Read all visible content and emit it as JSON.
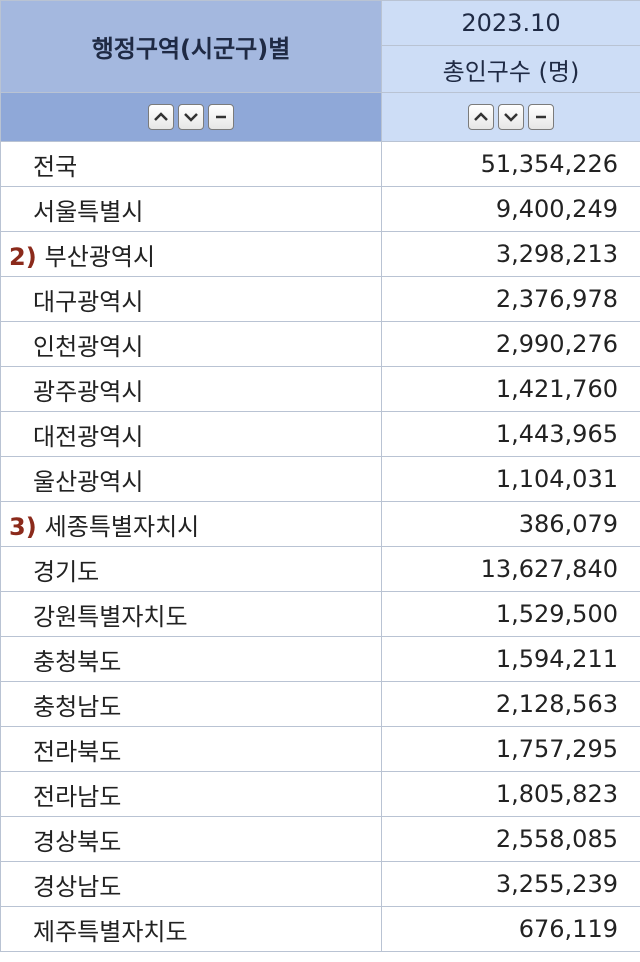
{
  "header": {
    "region_label": "행정구역(시군구)별",
    "period": "2023.10",
    "measure": "총인구수 (명)"
  },
  "controls": {
    "up_icon": "chevron-up-icon",
    "down_icon": "chevron-down-icon",
    "remove_icon": "minus-icon"
  },
  "rows": [
    {
      "note": "",
      "name": "전국",
      "value": "51,354,226"
    },
    {
      "note": "",
      "name": "서울특별시",
      "value": "9,400,249"
    },
    {
      "note": "2)",
      "name": "부산광역시",
      "value": "3,298,213"
    },
    {
      "note": "",
      "name": "대구광역시",
      "value": "2,376,978"
    },
    {
      "note": "",
      "name": "인천광역시",
      "value": "2,990,276"
    },
    {
      "note": "",
      "name": "광주광역시",
      "value": "1,421,760"
    },
    {
      "note": "",
      "name": "대전광역시",
      "value": "1,443,965"
    },
    {
      "note": "",
      "name": "울산광역시",
      "value": "1,104,031"
    },
    {
      "note": "3)",
      "name": "세종특별자치시",
      "value": "386,079"
    },
    {
      "note": "",
      "name": "경기도",
      "value": "13,627,840"
    },
    {
      "note": "",
      "name": "강원특별자치도",
      "value": "1,529,500"
    },
    {
      "note": "",
      "name": "충청북도",
      "value": "1,594,211"
    },
    {
      "note": "",
      "name": "충청남도",
      "value": "2,128,563"
    },
    {
      "note": "",
      "name": "전라북도",
      "value": "1,757,295"
    },
    {
      "note": "",
      "name": "전라남도",
      "value": "1,805,823"
    },
    {
      "note": "",
      "name": "경상북도",
      "value": "2,558,085"
    },
    {
      "note": "",
      "name": "경상남도",
      "value": "3,255,239"
    },
    {
      "note": "",
      "name": "제주특별자치도",
      "value": "676,119"
    }
  ]
}
